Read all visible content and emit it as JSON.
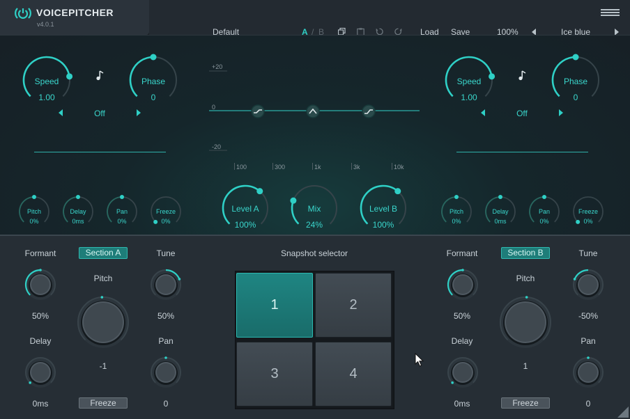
{
  "app": {
    "name": "VOICEPITCHER",
    "version": "v4.0.1"
  },
  "toolbar": {
    "preset": "Default",
    "ab_a": "A",
    "ab_sep": "/",
    "ab_b": "B",
    "load": "Load",
    "save": "Save",
    "zoom": "100%",
    "theme": "Ice blue",
    "icons": [
      "copy-icon",
      "paste-icon",
      "undo-icon",
      "redo-icon",
      "menu-icon"
    ]
  },
  "left_lfo": {
    "speed_label": "Speed",
    "speed_value": "1.00",
    "speed_level": 0.8,
    "phase_label": "Phase",
    "phase_value": "0",
    "phase_level": 0.5,
    "sync_icon": "note-icon",
    "mode_value": "Off"
  },
  "right_lfo": {
    "speed_label": "Speed",
    "speed_value": "1.00",
    "speed_level": 0.8,
    "phase_label": "Phase",
    "phase_value": "0",
    "phase_level": 0.5,
    "sync_icon": "note-icon",
    "mode_value": "Off"
  },
  "eq": {
    "db_top": "+20",
    "db_mid": "0",
    "db_bottom": "-20",
    "freqs": [
      "100",
      "300",
      "1k",
      "3k",
      "10k"
    ],
    "bands": [
      "low-shelf-icon",
      "peak-icon",
      "high-shelf-icon"
    ]
  },
  "left_small": [
    {
      "label": "Pitch",
      "value": "0%",
      "level": 0.5
    },
    {
      "label": "Delay",
      "value": "0ms",
      "level": 0.5
    },
    {
      "label": "Pan",
      "value": "0%",
      "level": 0.5
    },
    {
      "label": "Freeze",
      "value": "0%",
      "level": 0.0
    }
  ],
  "right_small": [
    {
      "label": "Pitch",
      "value": "0%",
      "level": 0.5
    },
    {
      "label": "Delay",
      "value": "0ms",
      "level": 0.5
    },
    {
      "label": "Pan",
      "value": "0%",
      "level": 0.5
    },
    {
      "label": "Freeze",
      "value": "0%",
      "level": 0.0
    }
  ],
  "mixer": {
    "level_a_label": "Level A",
    "level_a_value": "100%",
    "level_a_level": 0.65,
    "mix_label": "Mix",
    "mix_value": "24%",
    "mix_level": 0.24,
    "level_b_label": "Level B",
    "level_b_value": "100%",
    "level_b_level": 0.65
  },
  "section_a": {
    "formant_label": "Formant",
    "formant_value": "50%",
    "section_label": "Section A",
    "tune_label": "Tune",
    "tune_value": "50%",
    "pitch_label": "Pitch",
    "pitch_value": "-1",
    "delay_label": "Delay",
    "delay_value": "0ms",
    "pan_label": "Pan",
    "pan_value": "0",
    "freeze_label": "Freeze"
  },
  "section_b": {
    "formant_label": "Formant",
    "formant_value": "50%",
    "section_label": "Section B",
    "tune_label": "Tune",
    "tune_value": "-50%",
    "pitch_label": "Pitch",
    "pitch_value": "1",
    "delay_label": "Delay",
    "delay_value": "0ms",
    "pan_label": "Pan",
    "pan_value": "0",
    "freeze_label": "Freeze"
  },
  "snapshot": {
    "title": "Snapshot selector",
    "pads": [
      "1",
      "2",
      "3",
      "4"
    ],
    "active": 0
  },
  "colors": {
    "accent": "#2fd0c6",
    "accent_dark": "#1e7d79",
    "bg": "#1e252b"
  }
}
